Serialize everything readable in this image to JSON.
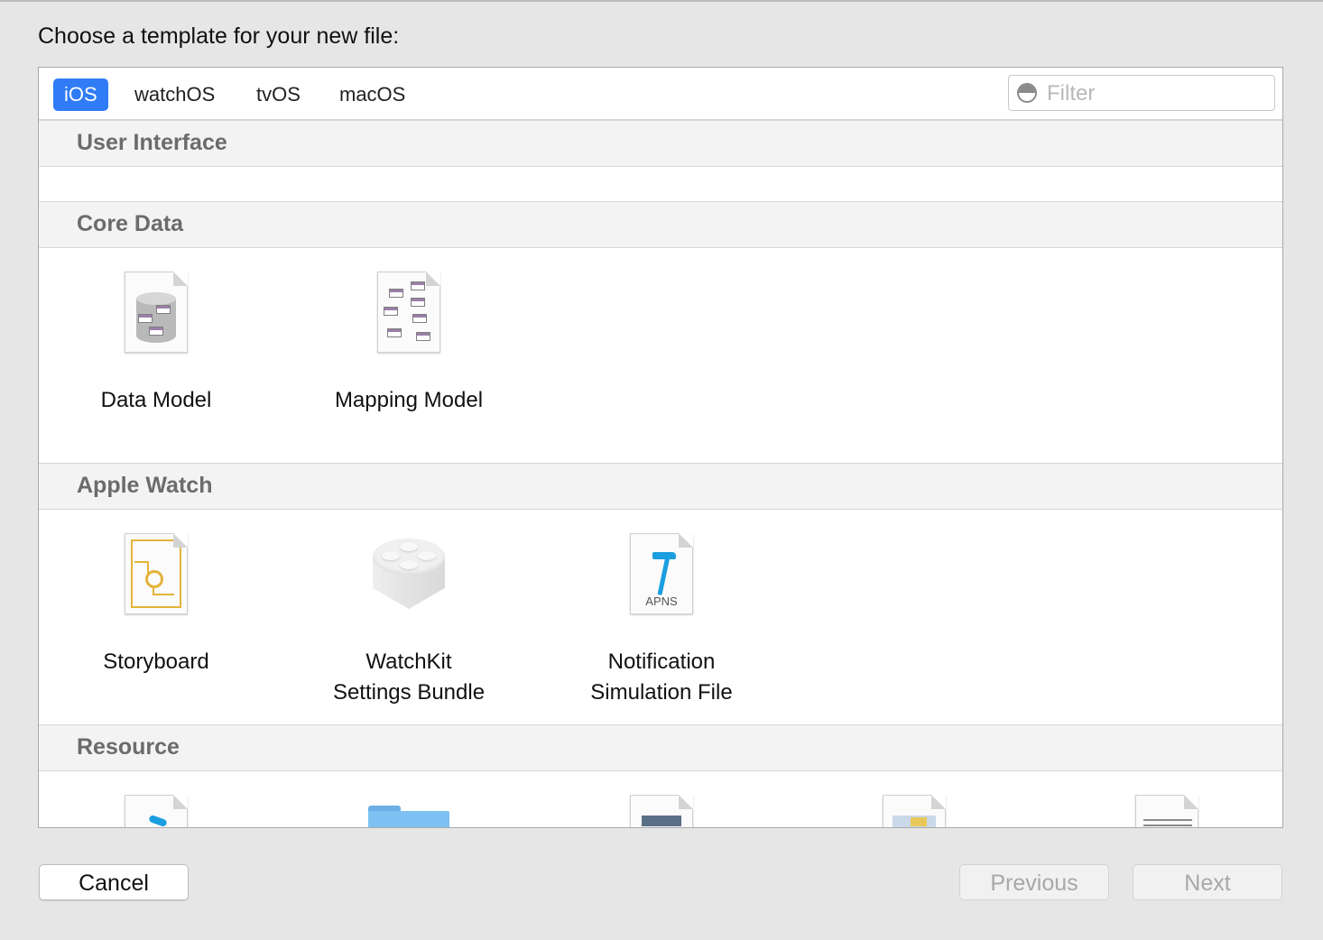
{
  "prompt": "Choose a template for your new file:",
  "tabs": [
    {
      "label": "iOS",
      "active": true
    },
    {
      "label": "watchOS",
      "active": false
    },
    {
      "label": "tvOS",
      "active": false
    },
    {
      "label": "macOS",
      "active": false
    }
  ],
  "filter": {
    "placeholder": "Filter",
    "value": ""
  },
  "sections": [
    {
      "title": "User Interface",
      "items": []
    },
    {
      "title": "Core Data",
      "items": [
        {
          "label": "Data Model",
          "icon": "data-model-icon"
        },
        {
          "label": "Mapping Model",
          "icon": "mapping-model-icon"
        }
      ]
    },
    {
      "title": "Apple Watch",
      "items": [
        {
          "label": "Storyboard",
          "icon": "storyboard-icon"
        },
        {
          "label": "WatchKit\nSettings Bundle",
          "icon": "settings-bundle-icon"
        },
        {
          "label": "Notification\nSimulation File",
          "icon": "apns-file-icon",
          "icon_text": "APNS"
        }
      ]
    },
    {
      "title": "Resource",
      "items": [
        {
          "icon": "swift-file-icon"
        },
        {
          "icon": "folder-icon"
        },
        {
          "icon": "document-icon"
        },
        {
          "icon": "image-document-icon"
        },
        {
          "icon": "list-document-icon"
        }
      ]
    }
  ],
  "buttons": {
    "cancel": "Cancel",
    "previous": "Previous",
    "next": "Next"
  },
  "colors": {
    "accent": "#2f7cf6",
    "storyboard": "#e4b33a",
    "apns_hammer": "#1a9ee0",
    "folder": "#7cc1f2"
  }
}
